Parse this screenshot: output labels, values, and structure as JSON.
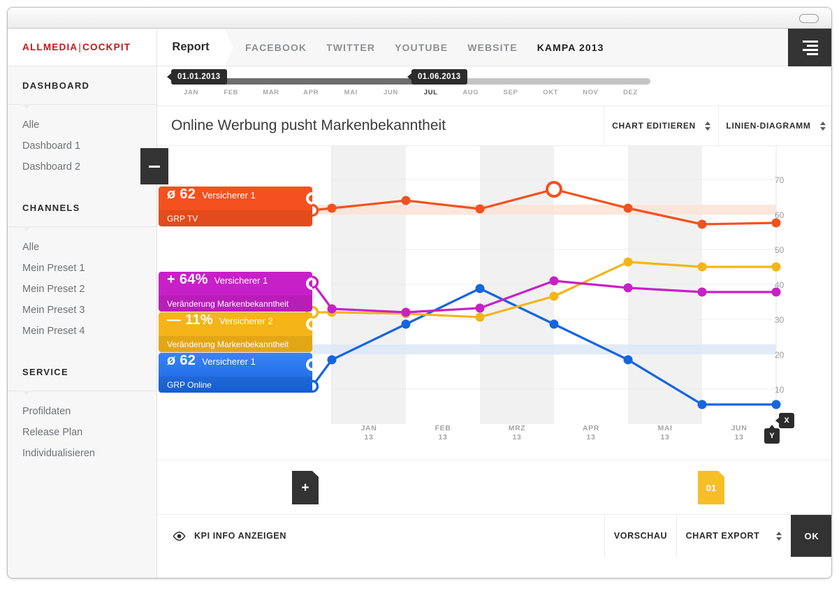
{
  "brand": {
    "left": "ALLMEDIA",
    "divider": "|",
    "right": "COCKPIT"
  },
  "topnav": {
    "report_tab": "Report",
    "links": [
      {
        "label": "FACEBOOK",
        "active": false
      },
      {
        "label": "TWITTER",
        "active": false
      },
      {
        "label": "YOUTUBE",
        "active": false
      },
      {
        "label": "WEBSITE",
        "active": false
      },
      {
        "label": "KAMPA 2013",
        "active": true
      }
    ],
    "menu_icon": "hamburger-menu-icon"
  },
  "sidebar": {
    "collapse_icon": "minus-icon",
    "sections": [
      {
        "heading": "DASHBOARD",
        "items": [
          "Alle",
          "Dashboard 1",
          "Dashboard 2"
        ]
      },
      {
        "heading": "CHANNELS",
        "items": [
          "Alle",
          "Mein Preset 1",
          "Mein Preset 2",
          "Mein Preset 3",
          "Mein Preset 4"
        ]
      },
      {
        "heading": "SERVICE",
        "items": [
          "Profildaten",
          "Release Plan",
          "Individualisieren"
        ]
      }
    ]
  },
  "timeline": {
    "start_label": "01.01.2013",
    "end_label": "01.06.2013",
    "months": [
      "JAN",
      "FEB",
      "MAR",
      "APR",
      "MAI",
      "JUN",
      "JUL",
      "AUG",
      "SEP",
      "OKT",
      "NOV",
      "DEZ"
    ],
    "active_month": "JUL",
    "fill_percent": 51
  },
  "chartbar": {
    "title": "Online Werbung pusht Markenbekanntheit",
    "edit_label": "CHART EDITIEREN",
    "type_label": "LINIEN-DIAGRAMM"
  },
  "kpis": [
    {
      "value": "ø 62",
      "entity": "Versicherer 1",
      "metric": "GRP TV",
      "color": "#f4511e"
    },
    {
      "value": "+ 64%",
      "entity": "Versicherer 1",
      "metric": "Veränderung Markenbekanntheit",
      "color": "#c820c8"
    },
    {
      "value": "— 11%",
      "entity": "Versicherer 2",
      "metric": "Veränderung Markenbekanntheit",
      "color": "#f5b418"
    },
    {
      "value": "ø 62",
      "entity": "Versicherer 1",
      "metric": "GRP Online",
      "color": "#1565e0"
    }
  ],
  "strip": {
    "add_label": "+",
    "tag_label": "01"
  },
  "footer": {
    "kpi_info_label": "KPI INFO ANZEIGEN",
    "kpi_info_icon": "eye-icon",
    "vorschau_label": "VORSCHAU",
    "export_label": "CHART EXPORT",
    "ok_label": "OK"
  },
  "axis_badges": {
    "x": "X",
    "y": "Y"
  },
  "chart_data": {
    "type": "line",
    "title": "Online Werbung pusht Markenbekanntheit",
    "xlabel": "",
    "ylabel": "",
    "x": [
      "JAN 13",
      "FEB 13",
      "MRZ 13",
      "APR 13",
      "MAI 13",
      "JUN 13"
    ],
    "x_tick_month": [
      "JAN",
      "FEB",
      "MRZ",
      "APR",
      "MAI",
      "JUN"
    ],
    "x_tick_year": [
      "13",
      "13",
      "13",
      "13",
      "13",
      "13"
    ],
    "ylim": [
      0,
      75
    ],
    "yticks": [
      10,
      20,
      30,
      40,
      50,
      60,
      70
    ],
    "grid": true,
    "legend_position": "left-inline-labels",
    "series": [
      {
        "name": "GRP TV — Versicherer 1",
        "color": "#f4511e",
        "summary_value": "ø 62",
        "start_value": 62,
        "values": [
          62,
          63,
          62,
          66,
          62,
          58,
          59
        ],
        "highlighted_point_index": 3
      },
      {
        "name": "Veränderung Markenbekanntheit — Versicherer 1",
        "color": "#c820c8",
        "summary_value": "+ 64%",
        "start_value": 37,
        "values": [
          37,
          28,
          27,
          28,
          33,
          31,
          30,
          30
        ]
      },
      {
        "name": "Veränderung Markenbekanntheit — Versicherer 2",
        "color": "#f5b418",
        "summary_value": "— 11%",
        "start_value": 25,
        "values": [
          25,
          25,
          25,
          24,
          29,
          38,
          37,
          37
        ]
      },
      {
        "name": "GRP Online — Versicherer 1",
        "color": "#1565e0",
        "summary_value": "ø 62",
        "start_value": 11,
        "values": [
          11,
          18,
          26,
          38,
          25,
          15,
          7,
          7
        ]
      }
    ]
  }
}
